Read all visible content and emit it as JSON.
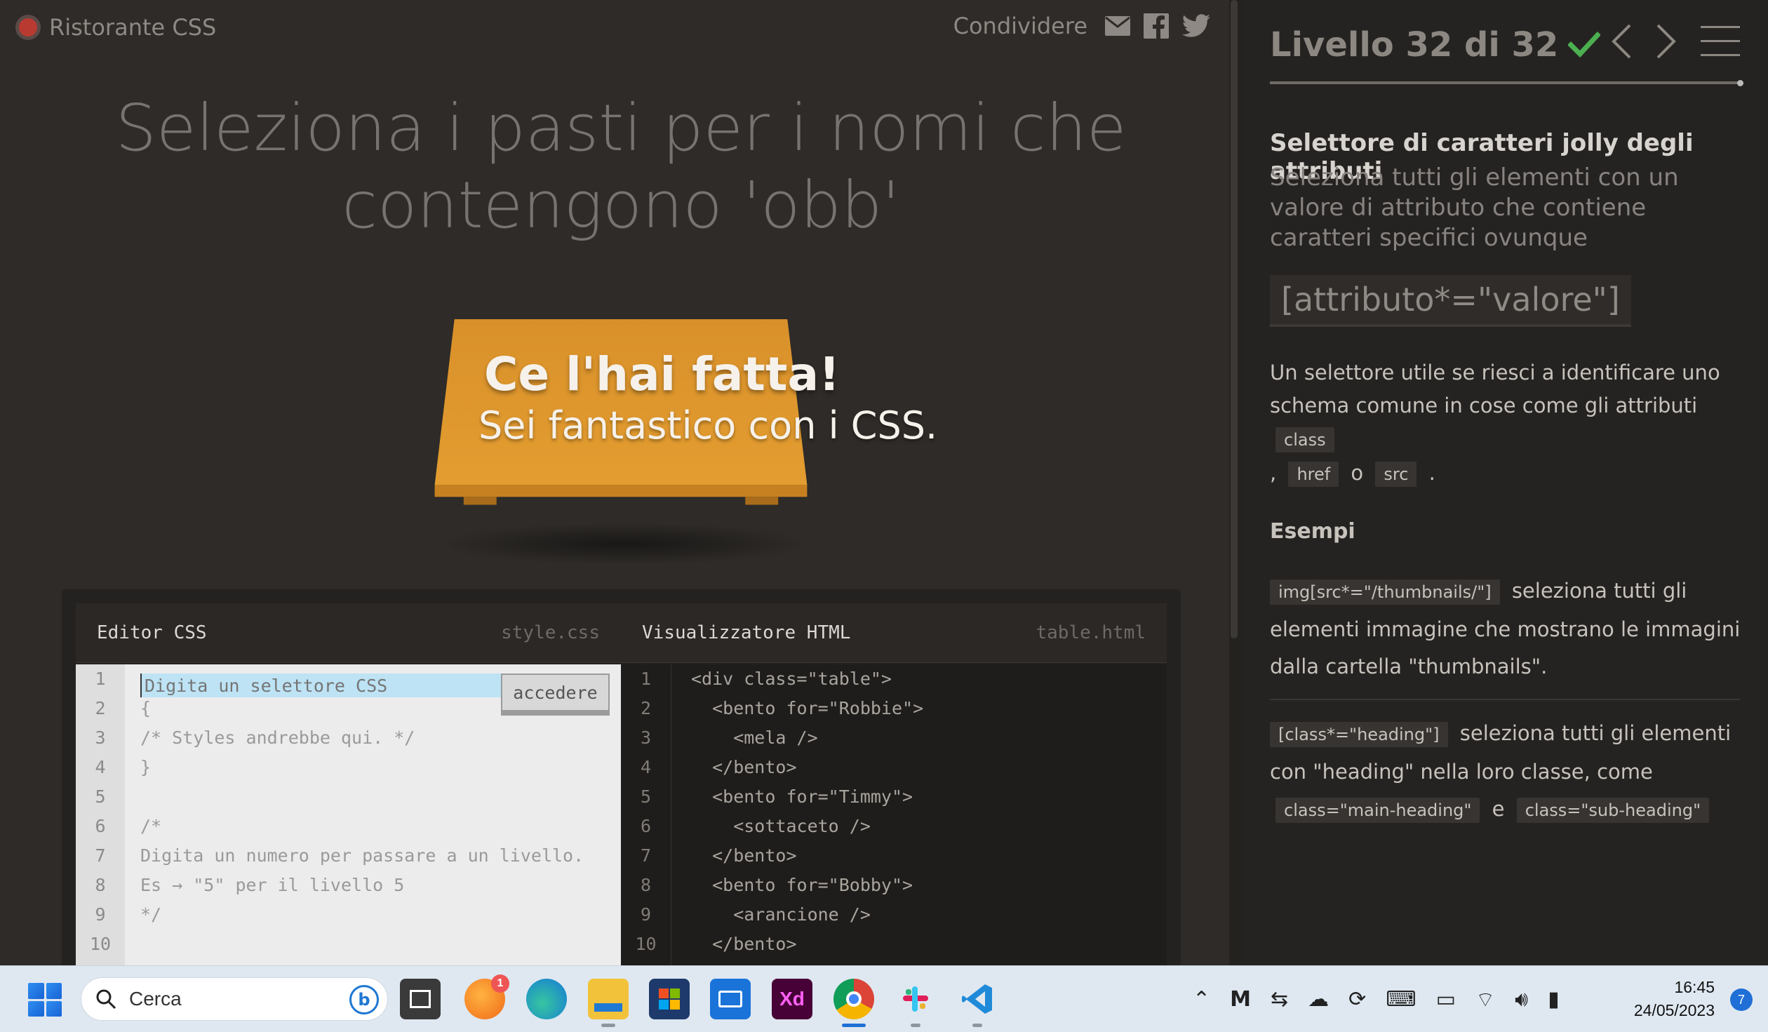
{
  "header": {
    "logo_text": "Ristorante CSS",
    "share_label": "Condividere"
  },
  "instruction": "Seleziona i pasti per i nomi che contengono 'obb'",
  "win": {
    "line1": "Ce l'hai fatta!",
    "line2": "Sei fantastico con i CSS."
  },
  "editor": {
    "css_title": "Editor CSS",
    "css_file": "style.css",
    "html_title": "Visualizzatore HTML",
    "html_file": "table.html",
    "input_placeholder": "Digita un selettore CSS",
    "enter_label": "accedere",
    "css_line_numbers": [
      "1",
      "2",
      "3",
      "4",
      "5",
      "6",
      "7",
      "8",
      "9",
      "10"
    ],
    "css_lines": [
      "",
      "{",
      "/* Styles andrebbe qui. */",
      "}",
      "",
      "/*",
      "Digita un numero per passare a un livello.",
      "Es → \"5\" per il livello 5",
      "*/",
      ""
    ],
    "html_line_numbers": [
      "1",
      "2",
      "3",
      "4",
      "5",
      "6",
      "7",
      "8",
      "9",
      "10"
    ],
    "html_lines": [
      "<div class=\"table\">",
      "  <bento for=\"Robbie\">",
      "    <mela />",
      "  </bento>",
      "  <bento for=\"Timmy\">",
      "    <sottaceto />",
      "  </bento>",
      "  <bento for=\"Bobby\">",
      "    <arancione />",
      "  </bento>"
    ]
  },
  "sidebar": {
    "level_text": "Livello 32 di 32",
    "selector_name": "Selettore di caratteri jolly degli attributi",
    "selector_title": "Seleziona tutti gli elementi con un valore di attributo che contiene caratteri specifici ovunque",
    "syntax": "[attributo*=\"valore\"]",
    "hint_text": "Un selettore utile se riesci a identificare uno schema comune in cose come gli attributi",
    "hint_code1": "class",
    "hint_sep1": ",",
    "hint_code2": "href",
    "hint_sep2": "o",
    "hint_code3": "src",
    "hint_end": ".",
    "examples_title": "Esempi",
    "ex1_code": "img[src*=\"/thumbnails/\"]",
    "ex1_text": "seleziona tutti gli elementi immagine che mostrano le immagini dalla cartella \"thumbnails\".",
    "ex2_code": "[class*=\"heading\"]",
    "ex2_text": "seleziona tutti gli elementi con \"heading\" nella loro classe, come",
    "ex2_code2": "class=\"main-heading\"",
    "ex2_sep": "e",
    "ex2_code3": "class=\"sub-heading\""
  },
  "taskbar": {
    "search_placeholder": "Cerca",
    "bing_label": "b",
    "firefox_badge": "1",
    "xd_label": "Xd",
    "time": "16:45",
    "date": "24/05/2023",
    "notification_count": "7"
  },
  "colors": {
    "accent_check": "#4caf50",
    "table_orange": "#e0962b",
    "selection_blue": "#bde3f5"
  }
}
